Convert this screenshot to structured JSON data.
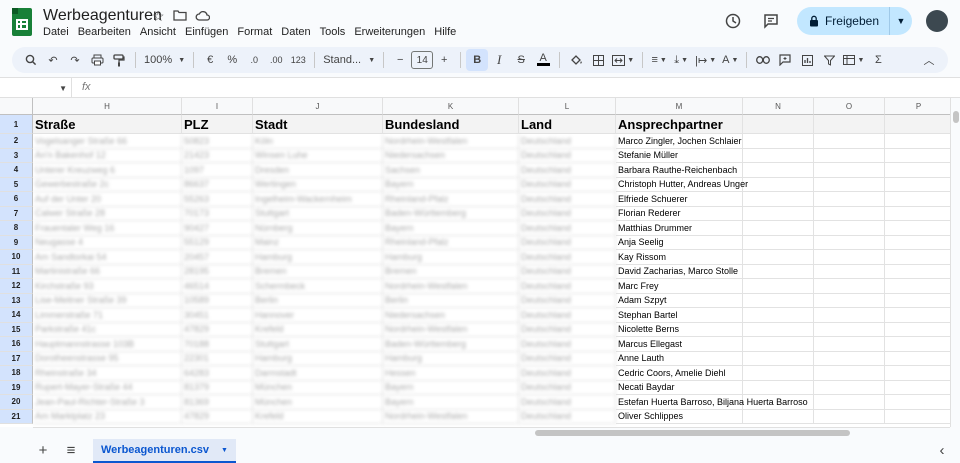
{
  "doc": {
    "title": "Werbeagenturen"
  },
  "menu": [
    "Datei",
    "Bearbeiten",
    "Ansicht",
    "Einfügen",
    "Format",
    "Daten",
    "Tools",
    "Erweiterungen",
    "Hilfe"
  ],
  "share": {
    "label": "Freigeben"
  },
  "toolbar": {
    "zoom": "100%",
    "currency": "€",
    "percent": "%",
    "dec_minus": ".0",
    "dec_plus": ".00",
    "number_format": "123",
    "font": "Stand...",
    "font_size": "14"
  },
  "formula": {
    "fx": "fx"
  },
  "columns": [
    "H",
    "I",
    "J",
    "K",
    "L",
    "M",
    "N",
    "O",
    "P"
  ],
  "header_row": {
    "H": "Straße",
    "I": "PLZ",
    "J": "Stadt",
    "K": "Bundesland",
    "L": "Land",
    "M": "Ansprechpartner"
  },
  "rows": [
    {
      "n": "2",
      "H": "Vogelsanger Straße 66",
      "I": "50823",
      "J": "Köln",
      "K": "Nordrhein-Westfalen",
      "L": "Deutschland",
      "M": "Marco Zingler, Jochen Schlaier"
    },
    {
      "n": "3",
      "H": "An'n Bakenhof 12",
      "I": "21423",
      "J": "Winsen Luhe",
      "K": "Niedersachsen",
      "L": "Deutschland",
      "M": "Stefanie Müller"
    },
    {
      "n": "4",
      "H": "Unterer Kreuzweg 6",
      "I": "1097",
      "J": "Dresden",
      "K": "Sachsen",
      "L": "Deutschland",
      "M": "Barbara Rauthe-Reichenbach"
    },
    {
      "n": "5",
      "H": "Gewerbestraße 2c",
      "I": "86637",
      "J": "Wertingen",
      "K": "Bayern",
      "L": "Deutschland",
      "M": "Christoph Hutter, Andreas Unger"
    },
    {
      "n": "6",
      "H": "Auf der Unter 20",
      "I": "55263",
      "J": "Ingelheim-Wackernheim",
      "K": "Rheinland-Pfalz",
      "L": "Deutschland",
      "M": "Elfriede Schuerer"
    },
    {
      "n": "7",
      "H": "Calwer Straße 28",
      "I": "70173",
      "J": "Stuttgart",
      "K": "Baden-Württemberg",
      "L": "Deutschland",
      "M": "Florian Rederer"
    },
    {
      "n": "8",
      "H": "Frauentaler Weg 16",
      "I": "90427",
      "J": "Nürnberg",
      "K": "Bayern",
      "L": "Deutschland",
      "M": "Matthias Drummer"
    },
    {
      "n": "9",
      "H": "Neugasse 4",
      "I": "55129",
      "J": "Mainz",
      "K": "Rheinland-Pfalz",
      "L": "Deutschland",
      "M": "Anja Seelig"
    },
    {
      "n": "10",
      "H": "Am Sandtorkai 54",
      "I": "20457",
      "J": "Hamburg",
      "K": "Hamburg",
      "L": "Deutschland",
      "M": "Kay Rissom"
    },
    {
      "n": "11",
      "H": "Martinistraße 66",
      "I": "28195",
      "J": "Bremen",
      "K": "Bremen",
      "L": "Deutschland",
      "M": "David Zacharias, Marco Stolle"
    },
    {
      "n": "12",
      "H": "Kirchstraße 93",
      "I": "46514",
      "J": "Schermbeck",
      "K": "Nordrhein-Westfalen",
      "L": "Deutschland",
      "M": "Marc Frey"
    },
    {
      "n": "13",
      "H": "Lise-Meitner Straße 39",
      "I": "10589",
      "J": "Berlin",
      "K": "Berlin",
      "L": "Deutschland",
      "M": "Adam Szpyt"
    },
    {
      "n": "14",
      "H": "Limmerstraße 71",
      "I": "30451",
      "J": "Hannover",
      "K": "Niedersachsen",
      "L": "Deutschland",
      "M": "Stephan Bartel"
    },
    {
      "n": "15",
      "H": "Parkstraße 41c",
      "I": "47829",
      "J": "Krefeld",
      "K": "Nordrhein-Westfalen",
      "L": "Deutschland",
      "M": "Nicolette Berns"
    },
    {
      "n": "16",
      "H": "Hauptmannstrasse 103B",
      "I": "70188",
      "J": "Stuttgart",
      "K": "Baden-Württemberg",
      "L": "Deutschland",
      "M": "Marcus Ellegast"
    },
    {
      "n": "17",
      "H": "Dorotheenstrasse 95",
      "I": "22301",
      "J": "Hamburg",
      "K": "Hamburg",
      "L": "Deutschland",
      "M": "Anne Lauth"
    },
    {
      "n": "18",
      "H": "Rheinstraße 34",
      "I": "64283",
      "J": "Darmstadt",
      "K": "Hessen",
      "L": "Deutschland",
      "M": "Cedric Coors, Amelie Diehl"
    },
    {
      "n": "19",
      "H": "Rupert-Mayer-Straße 44",
      "I": "81379",
      "J": "München",
      "K": "Bayern",
      "L": "Deutschland",
      "M": "Necati Baydar"
    },
    {
      "n": "20",
      "H": "Jean-Paul-Richter-Straße 3",
      "I": "81369",
      "J": "München",
      "K": "Bayern",
      "L": "Deutschland",
      "M": "Estefan Huerta Barroso, Biljana Huerta Barroso"
    },
    {
      "n": "21",
      "H": "Am Marktplatz 23",
      "I": "47829",
      "J": "Krefeld",
      "K": "Nordrhein-Westfalen",
      "L": "Deutschland",
      "M": "Oliver Schlippes"
    }
  ],
  "sheet": {
    "tab_label": "Werbeagenturen.csv"
  },
  "colors": {
    "accent": "#0b57d0",
    "share_bg": "#c2e7ff",
    "row_header": "#d3e3fd"
  }
}
